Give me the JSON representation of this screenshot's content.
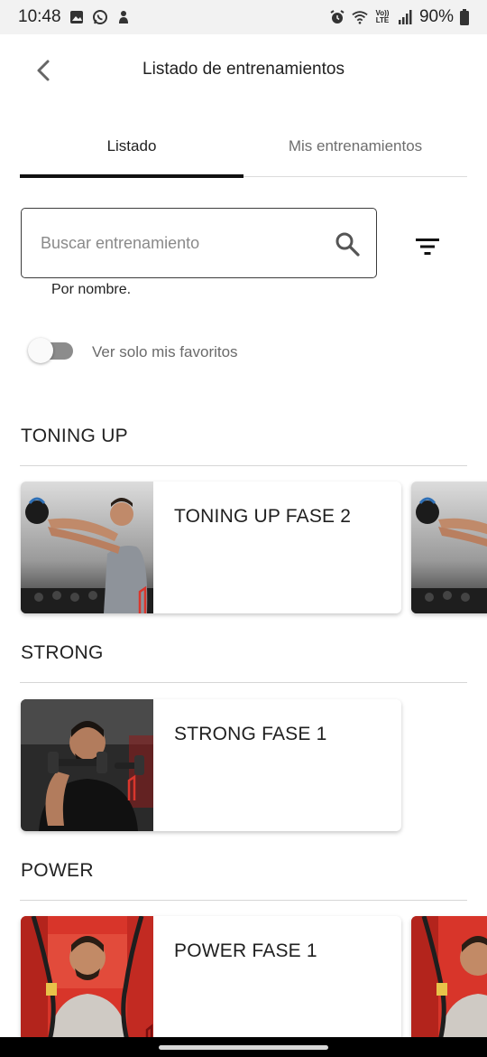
{
  "status_bar": {
    "time": "10:48",
    "battery": "90%",
    "icons": [
      "gallery-icon",
      "whatsapp-icon",
      "app-notification-icon",
      "alarm-icon",
      "wifi-icon",
      "volte-icon",
      "signal-icon",
      "battery-icon"
    ],
    "volte_text": "Vo)) LTE"
  },
  "header": {
    "title": "Listado de entrenamientos",
    "back_icon": "chevron-left-icon"
  },
  "tabs": [
    {
      "label": "Listado",
      "active": true
    },
    {
      "label": "Mis entrenamientos",
      "active": false
    }
  ],
  "search": {
    "placeholder": "Buscar entrenamiento",
    "value": "",
    "helper": "Por nombre.",
    "icon": "search-icon",
    "filter_icon": "filter-icon"
  },
  "favorites_toggle": {
    "label": "Ver solo mis favoritos",
    "checked": false
  },
  "sections": [
    {
      "title": "TONING UP",
      "cards": [
        {
          "title": "TONING UP FASE 2",
          "image": "man-kettlebell-swing-photo"
        }
      ],
      "has_more": true
    },
    {
      "title": "STRONG",
      "cards": [
        {
          "title": "STRONG FASE 1",
          "image": "man-dumbbell-curl-photo"
        }
      ],
      "has_more": false
    },
    {
      "title": "POWER",
      "cards": [
        {
          "title": "POWER FASE 1",
          "image": "man-battle-rope-photo"
        }
      ],
      "has_more": true
    }
  ],
  "colors": {
    "accent": "#111111",
    "tab_inactive": "#6e6e6e",
    "toggle_track": "#8c8c8c",
    "logo_red": "#e4202a"
  }
}
